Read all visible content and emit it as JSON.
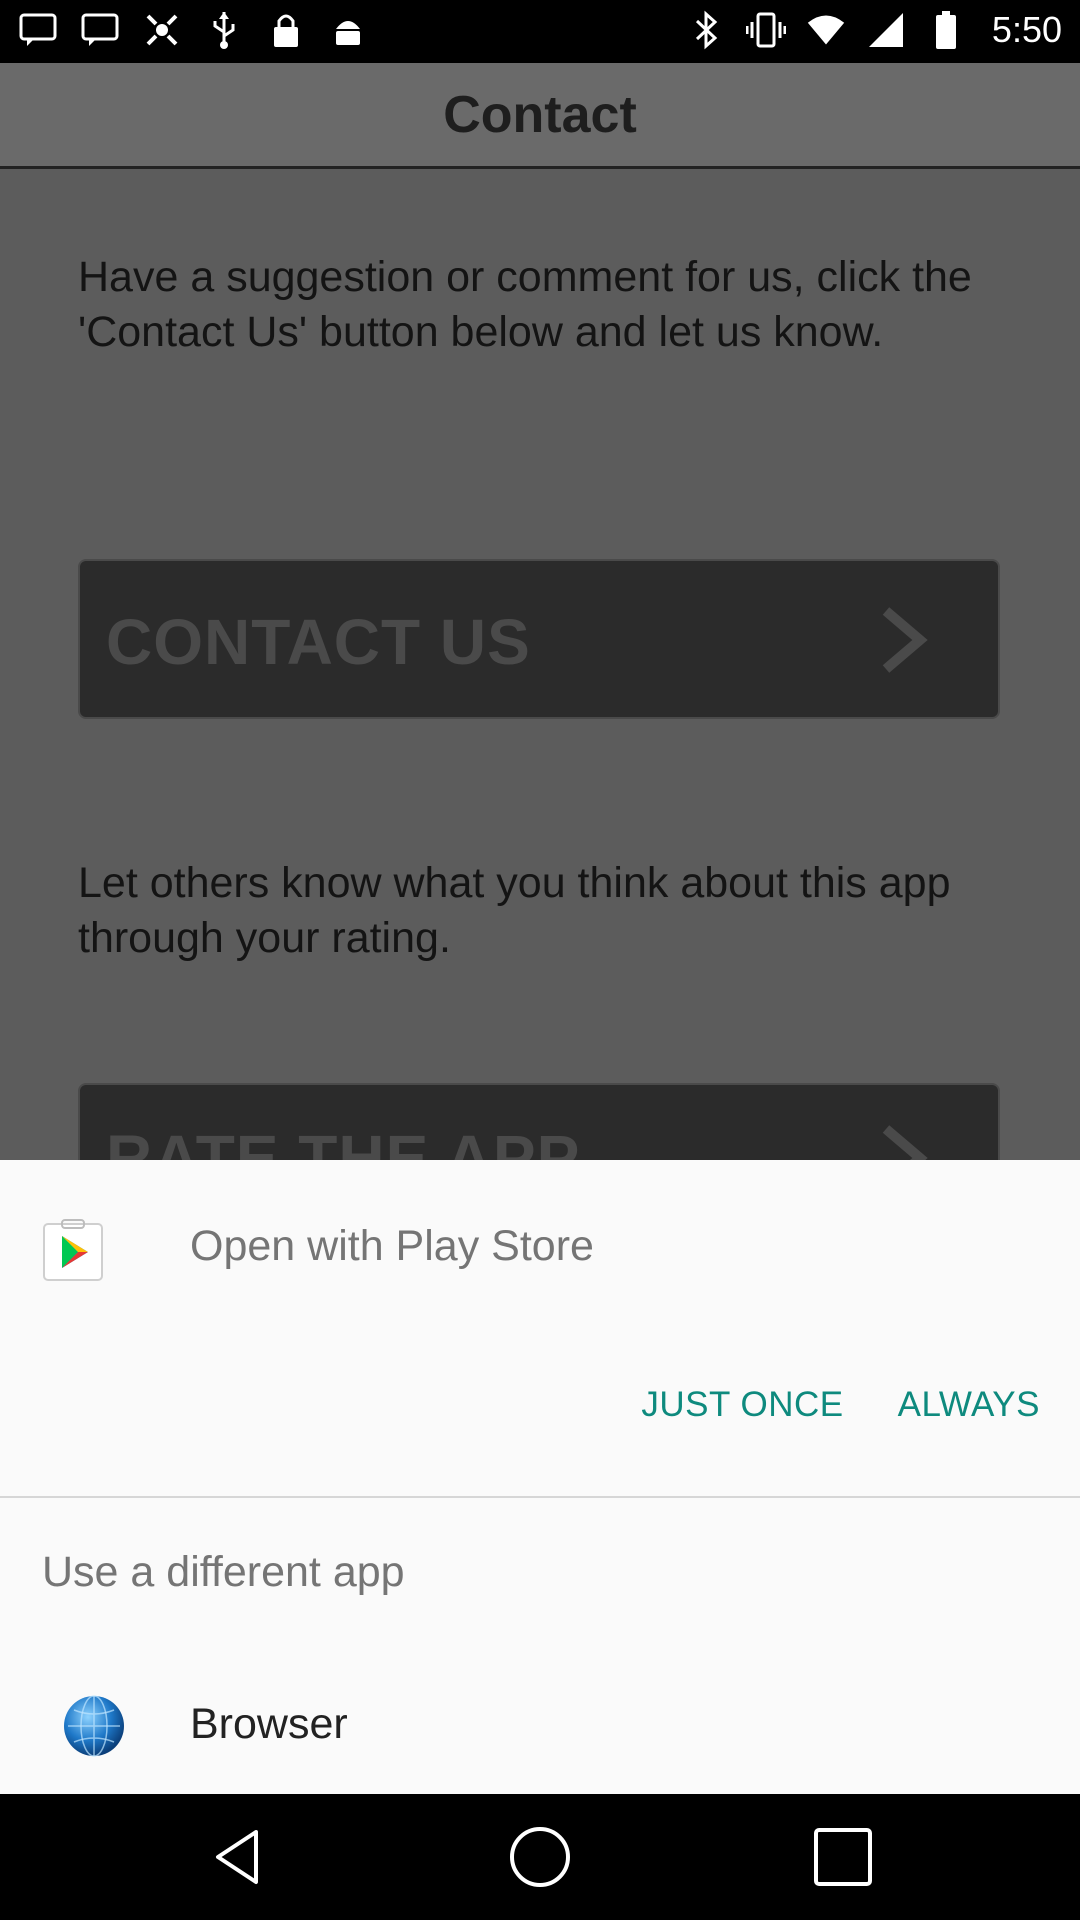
{
  "status_bar": {
    "time": "5:50",
    "left_icons": [
      "message-icon",
      "message-icon",
      "fake-gps-icon",
      "usb-icon",
      "lock-icon",
      "android-icon"
    ],
    "right_icons": [
      "bluetooth-icon",
      "vibrate-icon",
      "wifi-icon",
      "signal-icon",
      "battery-icon"
    ]
  },
  "app": {
    "title": "Contact",
    "paragraph1": "Have a suggestion or comment for us, click the 'Contact Us' button below and let us know.",
    "contact_button": "CONTACT US",
    "paragraph2": "Let others know what you think about this app through your rating.",
    "rate_button": "RATE THE APP"
  },
  "dialog": {
    "title": "Open with Play Store",
    "just_once": "JUST ONCE",
    "always": "ALWAYS",
    "different_app": "Use a different app",
    "browser": "Browser"
  },
  "colors": {
    "accent": "#0e8a7e",
    "sheet_bg": "#fafafa",
    "dim_bg": "#5c5c5c"
  },
  "nav": {
    "buttons": [
      "back-icon",
      "home-icon",
      "recents-icon"
    ]
  }
}
